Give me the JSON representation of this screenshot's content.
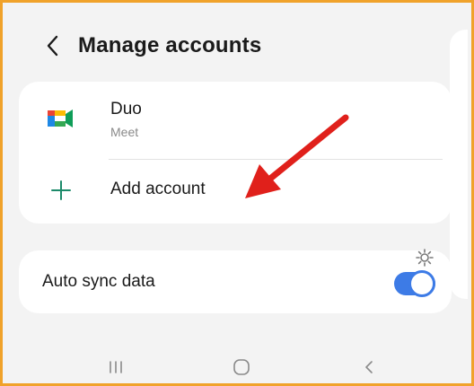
{
  "header": {
    "title": "Manage accounts",
    "back_icon": "chevron-left-icon"
  },
  "accounts": [
    {
      "name": "Duo",
      "type": "Meet",
      "icon": "google-meet-duo-icon"
    }
  ],
  "add_account": {
    "label": "Add account",
    "icon": "plus-icon",
    "icon_color": "#1c8a6a"
  },
  "auto_sync": {
    "label": "Auto sync data",
    "enabled": true,
    "toggle_color": "#3d7be6",
    "settings_icon": "gear-icon"
  },
  "nav_bar": {
    "buttons": [
      "recent-apps-icon",
      "home-icon",
      "back-icon"
    ]
  },
  "annotation": {
    "arrow_color": "#e0201b"
  },
  "colors": {
    "frame_border": "#f0a22a",
    "background": "#f3f3f3"
  }
}
